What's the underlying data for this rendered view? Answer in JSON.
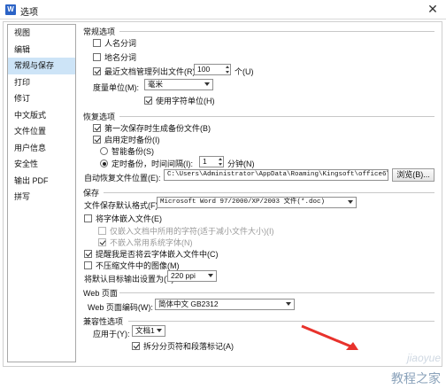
{
  "window": {
    "app_icon": "W",
    "title": "选项",
    "close_glyph": "✕"
  },
  "sidebar": {
    "items": [
      {
        "label": "视图"
      },
      {
        "label": "编辑"
      },
      {
        "label": "常规与保存",
        "active": true
      },
      {
        "label": "打印"
      },
      {
        "label": "修订"
      },
      {
        "label": "中文版式"
      },
      {
        "label": "文件位置"
      },
      {
        "label": "用户信息"
      },
      {
        "label": "安全性"
      },
      {
        "label": "输出 PDF"
      },
      {
        "label": "拼写"
      }
    ]
  },
  "general": {
    "title": "常规选项",
    "word_split_label": "人名分词",
    "word_split_checked": false,
    "place_split_label": "地名分词",
    "place_split_checked": false,
    "recent_label": "最近文档管理列出文件(R):",
    "recent_checked": true,
    "recent_value": "100",
    "recent_unit": "个(U)",
    "measure_label": "度量单位(M):",
    "measure_value": "毫米",
    "char_unit_label": "使用字符单位(H)",
    "char_unit_checked": true
  },
  "backup": {
    "title": "恢复选项",
    "first_save_label": "第一次保存时生成备份文件(B)",
    "first_save_checked": true,
    "timed_backup_label": "启用定时备份(I)",
    "timed_backup_checked": true,
    "smart_label": "智能备份(S)",
    "smart_selected": false,
    "timed_label": "定时备份，时间间隔(I):",
    "timed_selected": true,
    "interval_value": "1",
    "interval_unit": "分钟(N)",
    "path_label": "自动恢复文件位置(E):",
    "path_value": "C:\\Users\\Administrator\\AppData\\Roaming\\Kingsoft\\office6\\backup",
    "browse_label": "浏览(B)..."
  },
  "save": {
    "title": "保存",
    "format_label": "文件保存默认格式(F):",
    "format_value": "Microsoft Word 97/2000/XP/2003 文件(*.doc)",
    "embed_font_label": "将字体嵌入文件(E)",
    "embed_font_checked": false,
    "embed_used_label": "仅嵌入文档中所用的字符(适于减小文件大小)(I)",
    "embed_used_checked": false,
    "no_common_label": "不嵌入常用系统字体(N)",
    "no_common_checked": true,
    "remind_cloud_label": "提醒我是否将云字体嵌入文件中(C)",
    "remind_cloud_checked": true,
    "no_compress_label": "不压缩文件中的图像(M)",
    "no_compress_checked": false,
    "ppi_label": "将默认目标输出设置为(T):",
    "ppi_value": "220 ppi"
  },
  "web": {
    "title": "Web 页面",
    "encoding_label": "Web 页面编码(W):",
    "encoding_value": "简体中文 GB2312"
  },
  "compat": {
    "title": "兼容性选项",
    "apply_label": "应用于(Y):",
    "apply_value": "文档1",
    "split_label": "拆分分页符和段落标记(A)",
    "split_checked": true
  },
  "watermark": {
    "url": "jiaoyue",
    "text": "教程之家"
  },
  "colors": {
    "active_item": "#cde4f7",
    "annotation_arrow": "#e8322c"
  }
}
